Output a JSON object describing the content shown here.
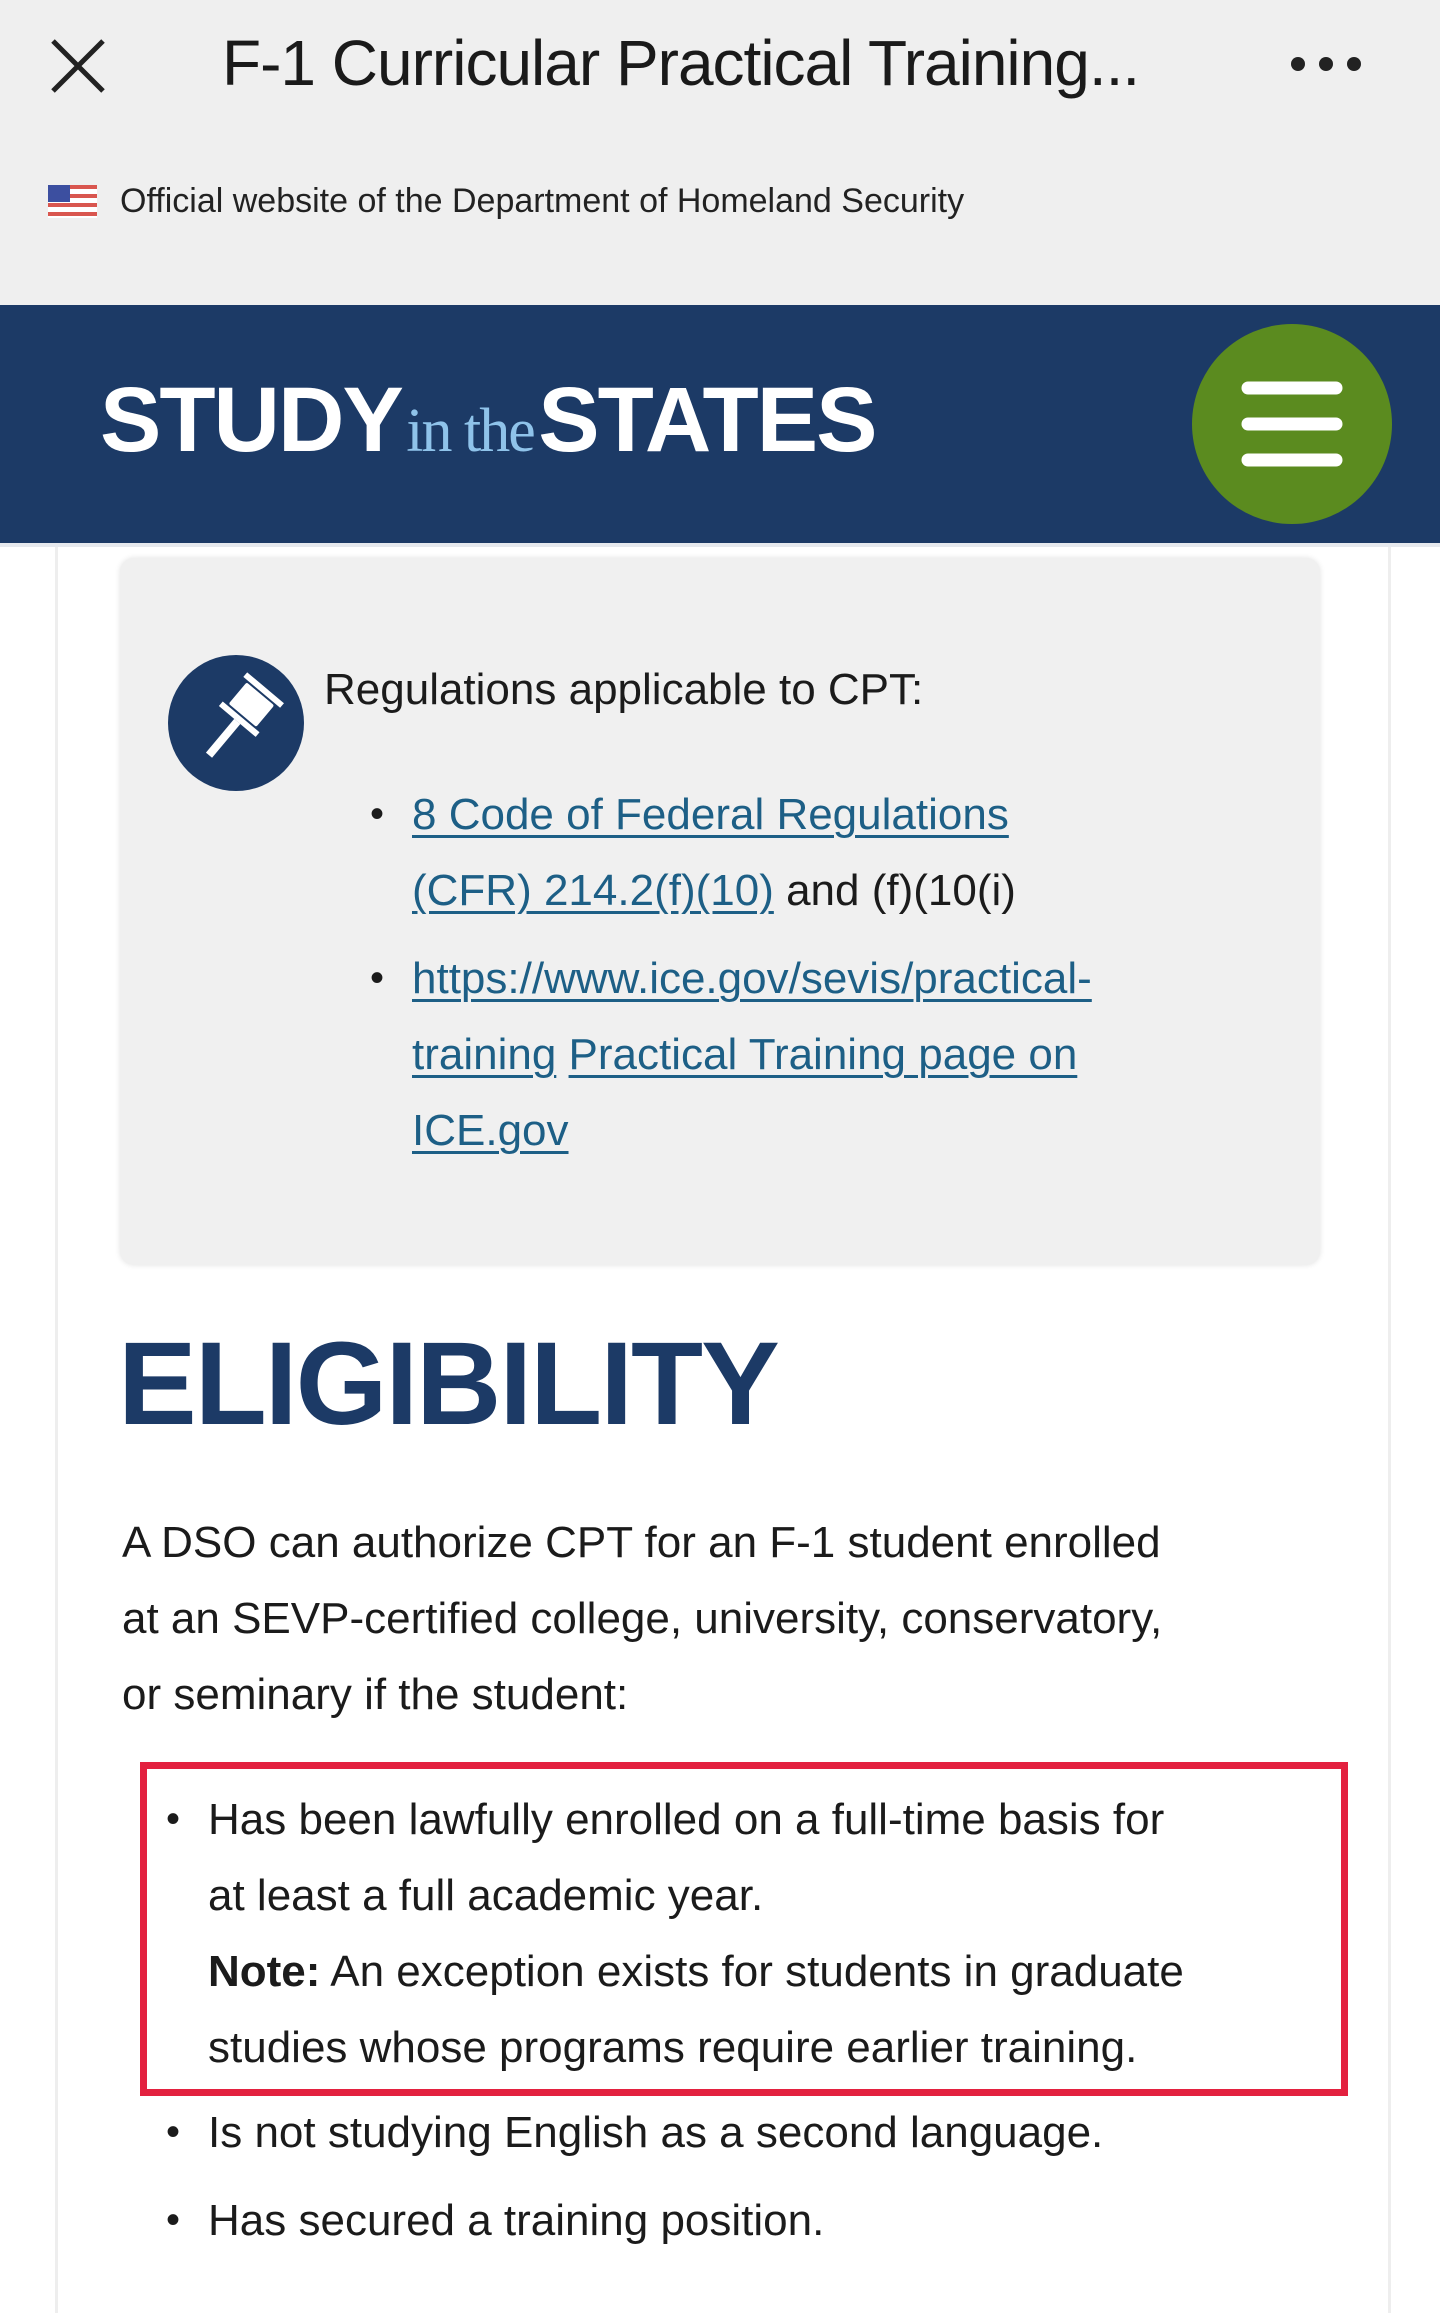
{
  "topbar": {
    "title": "F-1 Curricular Practical Training...",
    "close_icon": "close-icon",
    "more_icon": "more-horizontal-icon"
  },
  "banner": {
    "flag_icon": "us-flag-icon",
    "text": "Official website of the Department of Homeland Security"
  },
  "header": {
    "logo_part1": "STUDY",
    "logo_part2": "in the",
    "logo_part3": "STATES",
    "menu_icon": "hamburger-menu-icon",
    "colors": {
      "background": "#1c3a66",
      "menu_button": "#5b8b1f",
      "logo_accent": "#8fc3ea"
    }
  },
  "regulations": {
    "icon": "gavel-icon",
    "heading": "Regulations applicable to CPT:",
    "items": [
      {
        "link_line1": "8 Code of Federal Regulations",
        "link_line2": "(CFR) 214.2(f)(10)",
        "suffix": " and (f)(10(i)"
      },
      {
        "link_line1": "https://www.ice.gov/sevis/practical-",
        "link_line2a": "training",
        "link_line2b": "Practical Training page on",
        "link_line3": "ICE.gov"
      }
    ]
  },
  "eligibility": {
    "title": "ELIGIBILITY",
    "intro_lines": [
      "A DSO can authorize CPT for an F-1 student enrolled",
      "at an SEVP-certified college, university, conservatory,",
      "or seminary if the student:"
    ],
    "items": [
      {
        "lines": [
          "Has been lawfully enrolled on a full-time basis for",
          "at least a full academic year."
        ],
        "note_label": "Note:",
        "note_lines": [
          " An exception exists for students in graduate",
          "studies whose programs require earlier training."
        ],
        "highlighted": true
      },
      {
        "lines": [
          "Is not studying English as a second language."
        ]
      },
      {
        "lines": [
          "Has secured a training position."
        ]
      }
    ],
    "highlight_color": "#e3213f"
  }
}
